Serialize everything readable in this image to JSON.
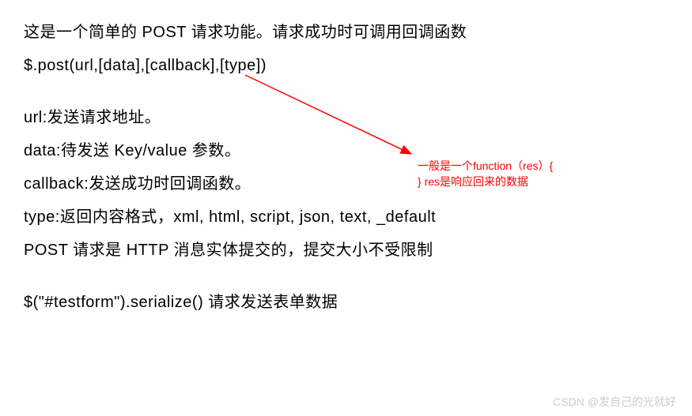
{
  "lines": {
    "intro": "这是一个简单的 POST 请求功能。请求成功时可调用回调函数",
    "syntax": "$.post(url,[data],[callback],[type])",
    "url": "url:发送请求地址。",
    "data": "data:待发送 Key/value 参数。",
    "callback": "callback:发送成功时回调函数。",
    "type": "type:返回内容格式，xml, html, script, json, text, _default",
    "post_note": "POST 请求是 HTTP 消息实体提交的，提交大小不受限制",
    "serialize": "$(\"#testform\").serialize() 请求发送表单数据"
  },
  "annotation": {
    "line1": "一般是一个function（res）{",
    "line2": "}   res是响应回来的数据"
  },
  "watermark": "CSDN @发自己的光就好",
  "colors": {
    "text": "#000000",
    "annotation": "#ff0000",
    "watermark": "#cccccc"
  }
}
